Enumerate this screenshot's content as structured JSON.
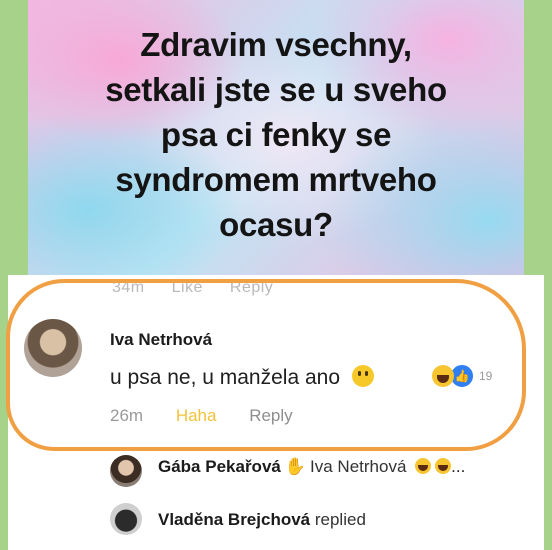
{
  "post": {
    "text": "Zdravim vsechny,\nsetkali jste se u sveho\npsa ci fenky se\nsyndromem mrtveho\nocasu?"
  },
  "ghost_actions": {
    "time": "34m",
    "like": "Like",
    "reply": "Reply"
  },
  "comment": {
    "author": "Iva Netrhová",
    "text": "u psa ne, u manžela ano",
    "reaction_count": "19",
    "time": "26m",
    "reaction_label": "Haha",
    "reply_label": "Reply"
  },
  "replies": [
    {
      "author": "Gába Pekařová",
      "mention": "Iva Netrhová",
      "suffix": "..."
    },
    {
      "author": "Vladěna Brejchová",
      "suffix": "replied"
    }
  ],
  "colors": {
    "highlight_ring": "#f0a043",
    "haha_reaction": "#f2c23a",
    "like_reaction": "#2f7ef2",
    "frame": "#a6d389"
  },
  "icons": [
    "smile-emoji-icon",
    "haha-reaction-icon",
    "like-reaction-icon",
    "waving-hand-icon"
  ]
}
